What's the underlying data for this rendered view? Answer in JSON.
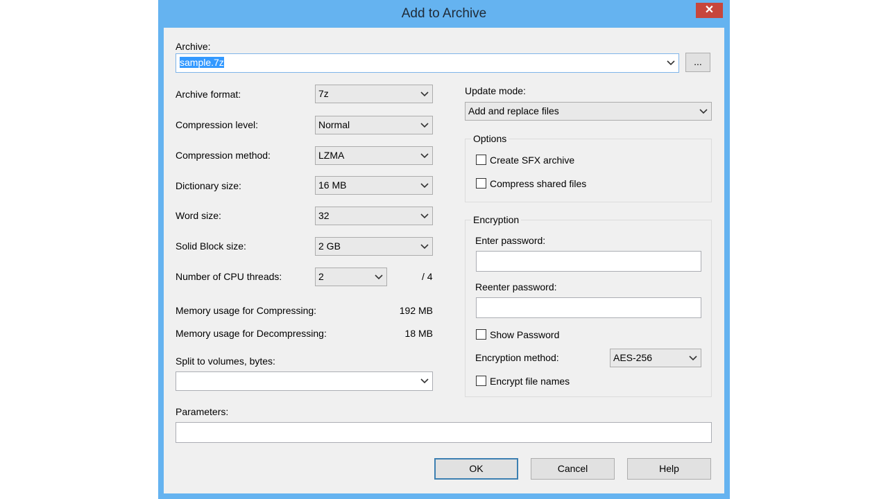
{
  "window": {
    "title": "Add to Archive",
    "close_glyph": "✕"
  },
  "archive": {
    "label": "Archive:",
    "value": "sample.7z",
    "browse_label": "..."
  },
  "left": {
    "archive_format": {
      "label": "Archive format:",
      "value": "7z"
    },
    "compression_level": {
      "label": "Compression level:",
      "value": "Normal"
    },
    "compression_method": {
      "label": "Compression method:",
      "value": "LZMA"
    },
    "dictionary_size": {
      "label": "Dictionary size:",
      "value": "16 MB"
    },
    "word_size": {
      "label": "Word size:",
      "value": "32"
    },
    "solid_block_size": {
      "label": "Solid Block size:",
      "value": "2 GB"
    },
    "cpu_threads": {
      "label": "Number of CPU threads:",
      "value": "2",
      "max": "/ 4"
    },
    "memory_compress": {
      "label": "Memory usage for Compressing:",
      "value": "192 MB"
    },
    "memory_decompress": {
      "label": "Memory usage for Decompressing:",
      "value": "18 MB"
    },
    "split_volumes": {
      "label": "Split to volumes, bytes:",
      "value": ""
    },
    "parameters": {
      "label": "Parameters:",
      "value": ""
    }
  },
  "right": {
    "update_mode": {
      "label": "Update mode:",
      "value": "Add and replace files"
    },
    "options": {
      "title": "Options",
      "create_sfx": {
        "label": "Create SFX archive",
        "checked": false
      },
      "compress_shared": {
        "label": "Compress shared files",
        "checked": false
      }
    },
    "encryption": {
      "title": "Encryption",
      "enter_password_label": "Enter password:",
      "enter_password_value": "",
      "reenter_password_label": "Reenter password:",
      "reenter_password_value": "",
      "show_password": {
        "label": "Show Password",
        "checked": false
      },
      "method": {
        "label": "Encryption method:",
        "value": "AES-256"
      },
      "encrypt_names": {
        "label": "Encrypt file names",
        "checked": false
      }
    }
  },
  "buttons": {
    "ok": "OK",
    "cancel": "Cancel",
    "help": "Help"
  },
  "colors": {
    "title_bar": "#65b3f0",
    "close_button": "#c7463c",
    "dialog_background": "#f0f0f0",
    "selection": "#3399ff"
  }
}
